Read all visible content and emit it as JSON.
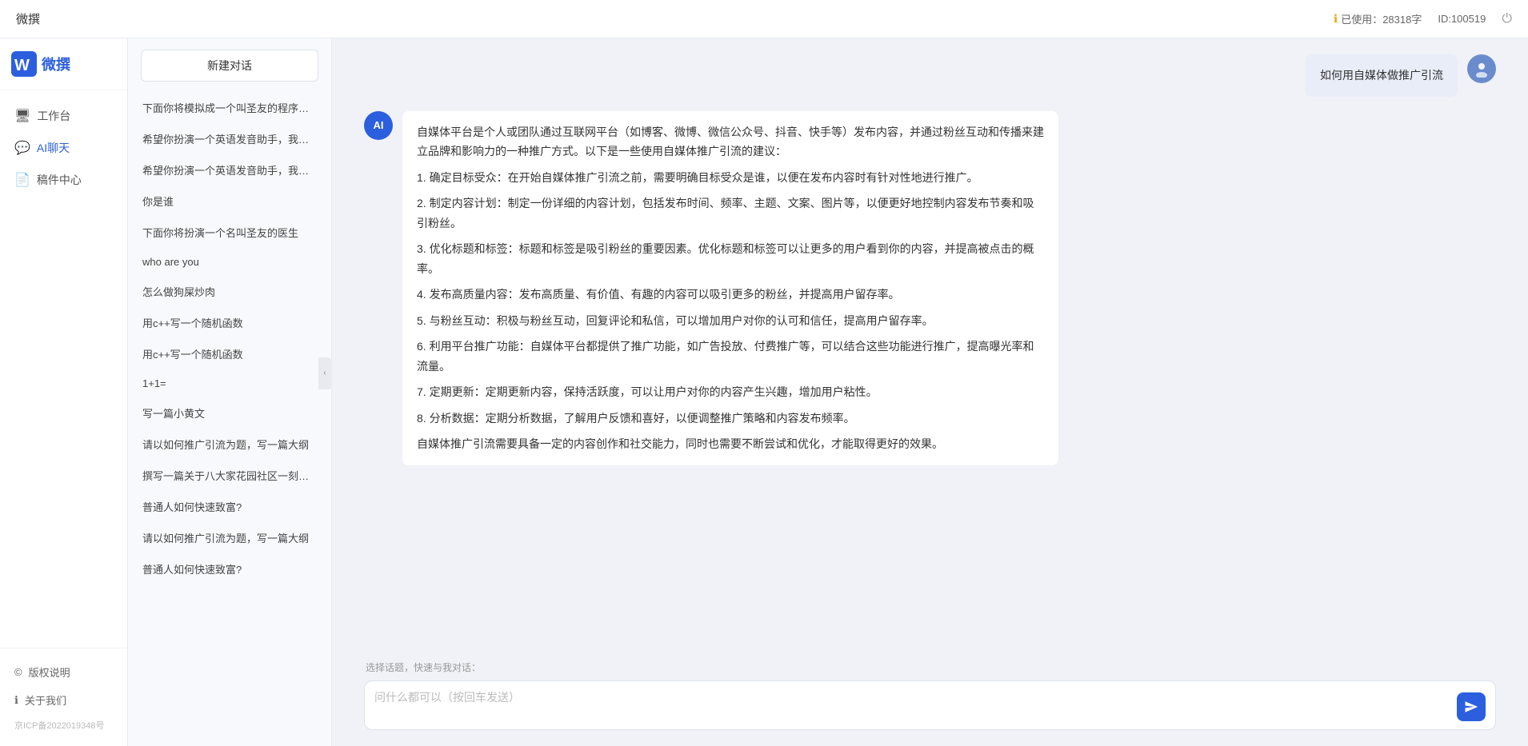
{
  "topbar": {
    "title": "微撰",
    "usage_label": "已使用：28318字",
    "id_label": "ID:100519",
    "usage_icon": "ℹ"
  },
  "sidebar": {
    "logo_text": "微撰",
    "nav_items": [
      {
        "label": "工作台",
        "icon": "🖥",
        "active": false
      },
      {
        "label": "AI聊天",
        "icon": "💬",
        "active": true
      },
      {
        "label": "稿件中心",
        "icon": "📄",
        "active": false
      }
    ],
    "footer_items": [
      {
        "label": "版权说明",
        "icon": "©"
      },
      {
        "label": "关于我们",
        "icon": "ℹ"
      }
    ],
    "icp": "京ICP备2022019348号"
  },
  "history": {
    "new_chat_label": "新建对话",
    "items": [
      {
        "text": "下面你将模拟成一个叫圣友的程序员，我说...",
        "active": false
      },
      {
        "text": "希望你扮演一个英语发音助手，我提供给你...",
        "active": false
      },
      {
        "text": "希望你扮演一个英语发音助手，我提供给你...",
        "active": false
      },
      {
        "text": "你是谁",
        "active": false
      },
      {
        "text": "下面你将扮演一个名叫圣友的医生",
        "active": false
      },
      {
        "text": "who are you",
        "active": false
      },
      {
        "text": "怎么做狗屎炒肉",
        "active": false
      },
      {
        "text": "用c++写一个随机函数",
        "active": false
      },
      {
        "text": "用c++写一个随机函数",
        "active": false
      },
      {
        "text": "1+1=",
        "active": false
      },
      {
        "text": "写一篇小黄文",
        "active": false
      },
      {
        "text": "请以如何推广引流为题，写一篇大纲",
        "active": false
      },
      {
        "text": "撰写一篇关于八大家花园社区一刻钟便民生...",
        "active": false
      },
      {
        "text": "普通人如何快速致富?",
        "active": false
      },
      {
        "text": "请以如何推广引流为题，写一篇大纲",
        "active": false
      },
      {
        "text": "普通人如何快速致富?",
        "active": false
      }
    ]
  },
  "chat": {
    "user_message": "如何用自媒体做推广引流",
    "ai_response": {
      "paragraphs": [
        "自媒体平台是个人或团队通过互联网平台（如博客、微博、微信公众号、抖音、快手等）发布内容，并通过粉丝互动和传播来建立品牌和影响力的一种推广方式。以下是一些使用自媒体推广引流的建议：",
        "1. 确定目标受众：在开始自媒体推广引流之前，需要明确目标受众是谁，以便在发布内容时有针对性地进行推广。",
        "2. 制定内容计划：制定一份详细的内容计划，包括发布时间、频率、主题、文案、图片等，以便更好地控制内容发布节奏和吸引粉丝。",
        "3. 优化标题和标签：标题和标签是吸引粉丝的重要因素。优化标题和标签可以让更多的用户看到你的内容，并提高被点击的概率。",
        "4. 发布高质量内容：发布高质量、有价值、有趣的内容可以吸引更多的粉丝，并提高用户留存率。",
        "5. 与粉丝互动：积极与粉丝互动，回复评论和私信，可以增加用户对你的认可和信任，提高用户留存率。",
        "6. 利用平台推广功能：自媒体平台都提供了推广功能，如广告投放、付费推广等，可以结合这些功能进行推广，提高曝光率和流量。",
        "7. 定期更新：定期更新内容，保持活跃度，可以让用户对你的内容产生兴趣，增加用户粘性。",
        "8. 分析数据：定期分析数据，了解用户反馈和喜好，以便调整推广策略和内容发布频率。",
        "自媒体推广引流需要具备一定的内容创作和社交能力，同时也需要不断尝试和优化，才能取得更好的效果。"
      ]
    },
    "quick_topic_label": "选择话题，快速与我对话：",
    "input_placeholder": "问什么都可以（按回车发送）"
  },
  "colors": {
    "accent": "#2c5fde",
    "bg": "#f0f2f7",
    "sidebar_bg": "#fff"
  }
}
